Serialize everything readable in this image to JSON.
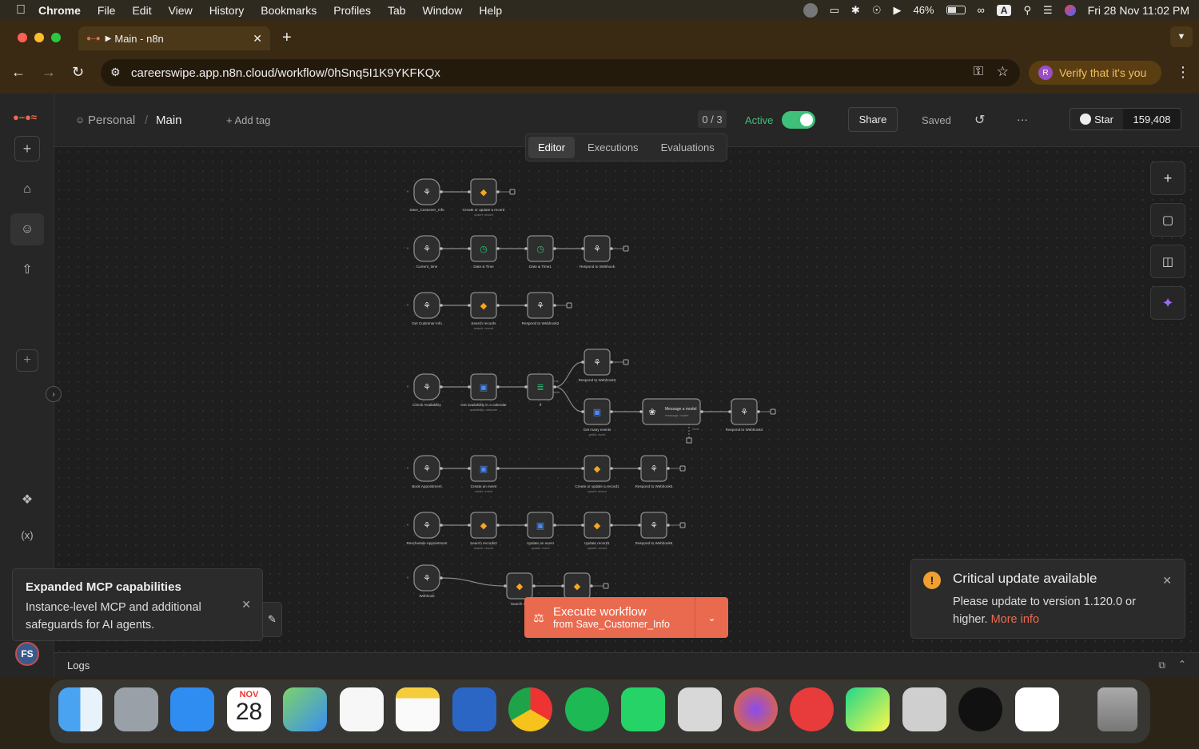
{
  "menubar": {
    "app": "Chrome",
    "items": [
      "File",
      "Edit",
      "View",
      "History",
      "Bookmarks",
      "Profiles",
      "Tab",
      "Window",
      "Help"
    ],
    "battery": "46%",
    "datetime": "Fri 28 Nov  11:02 PM",
    "input_source": "A"
  },
  "browser": {
    "tab_title": "Main - n8n",
    "url": "careerswipe.app.n8n.cloud/workflow/0hSnq5I1K9YKFKQx",
    "verify": "Verify that it's you"
  },
  "header": {
    "project": "Personal",
    "separator": "/",
    "workflow_name": "Main",
    "add_tag": "+ Add tag",
    "counter": "0 / 3",
    "active_label": "Active",
    "share": "Share",
    "saved": "Saved",
    "more": "···",
    "github_star": "Star",
    "github_count": "159,408"
  },
  "tabs": [
    "Editor",
    "Executions",
    "Evaluations"
  ],
  "nodes": [
    {
      "label": "Save_Customer_Info",
      "sub": ""
    },
    {
      "label": "Create or update a record",
      "sub": "upsert: record"
    },
    {
      "label": "Current_time",
      "sub": ""
    },
    {
      "label": "Date & Time",
      "sub": ""
    },
    {
      "label": "Date & Time1",
      "sub": ""
    },
    {
      "label": "Respond to Webhook",
      "sub": ""
    },
    {
      "label": "Get Customer Info",
      "sub": ""
    },
    {
      "label": "Search records",
      "sub": "search: record"
    },
    {
      "label": "Respond to Webhook2",
      "sub": ""
    },
    {
      "label": "Check Availability",
      "sub": ""
    },
    {
      "label": "Get availability in a calendar",
      "sub": "availability: calendar"
    },
    {
      "label": "If",
      "sub": ""
    },
    {
      "label": "Respond to Webhook3",
      "sub": ""
    },
    {
      "label": "Get many events",
      "sub": "getAll: event"
    },
    {
      "label": "Message a model",
      "sub": "message: model"
    },
    {
      "label": "Respond to Webhook4",
      "sub": ""
    },
    {
      "label": "Book Appointment",
      "sub": ""
    },
    {
      "label": "Create an event",
      "sub": "create: event"
    },
    {
      "label": "Create or update a record1",
      "sub": "upsert: record"
    },
    {
      "label": "Respond to Webhook5",
      "sub": ""
    },
    {
      "label": "Reschedule Appointment",
      "sub": ""
    },
    {
      "label": "Search records2",
      "sub": "search: record"
    },
    {
      "label": "Update an event",
      "sub": "update: event"
    },
    {
      "label": "Update record1",
      "sub": "update: record"
    },
    {
      "label": "Respond to Webhook6",
      "sub": ""
    },
    {
      "label": "Webhook",
      "sub": ""
    },
    {
      "label": "Search rec",
      "sub": ""
    },
    {
      "label": "",
      "sub": ""
    }
  ],
  "edge_labels": {
    "true": "true",
    "false": "false",
    "tools": "Tools"
  },
  "execute": {
    "title": "Execute workflow",
    "subtitle": "from Save_Customer_Info"
  },
  "toast_left": {
    "title": "Expanded MCP capabilities",
    "body": "Instance-level MCP and additional safeguards for AI agents."
  },
  "toast_right": {
    "title": "Critical update available",
    "body": "Please update to version 1.120.0 or higher.",
    "link": "More info"
  },
  "logs": {
    "label": "Logs"
  },
  "avatar": "FS",
  "dock_calendar": {
    "month": "NOV",
    "day": "28"
  },
  "colors": {
    "accent": "#ea6a4f",
    "active_green": "#3ec07a",
    "canvas": "#1e1e1e"
  }
}
